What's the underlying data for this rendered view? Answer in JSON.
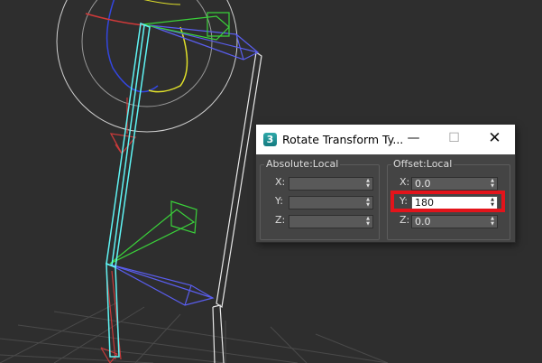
{
  "window": {
    "icon_glyph": "3",
    "icon_name": "3dsmax-app-icon",
    "title": "Rotate Transform Ty...",
    "minimize_glyph": "—",
    "maximize_glyph": "☐",
    "close_glyph": "✕"
  },
  "absolute_group": {
    "title": "Absolute:Local",
    "rows": [
      {
        "axis": "X:",
        "value": ""
      },
      {
        "axis": "Y:",
        "value": ""
      },
      {
        "axis": "Z:",
        "value": ""
      }
    ]
  },
  "offset_group": {
    "title": "Offset:Local",
    "rows": [
      {
        "axis": "X:",
        "value": "0.0"
      },
      {
        "axis": "Y:",
        "value": "180"
      },
      {
        "axis": "Z:",
        "value": "0.0"
      }
    ]
  },
  "spinner_arrows": {
    "up": "▲",
    "down": "▼"
  },
  "colors": {
    "viewport_bg": "#2e2e2e",
    "dialog_bg": "#444444",
    "highlight": "#e3141b",
    "selected_bone": "#5ff4f4",
    "bone_blue": "#5a5ef0",
    "bone_green": "#3ad23a",
    "bone_red": "#c83a3a",
    "bone_white": "#e8e8e8"
  }
}
